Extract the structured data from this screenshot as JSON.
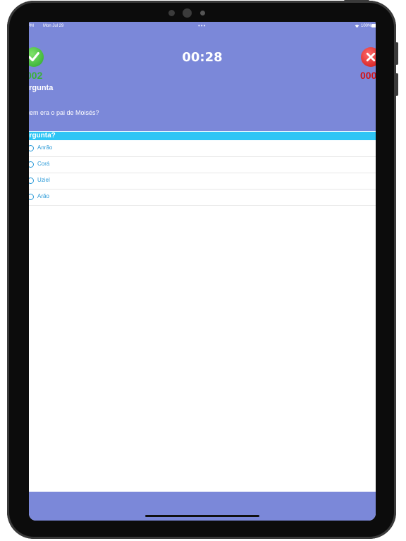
{
  "status_bar": {
    "time": "PM",
    "date": "Mon Jul 29",
    "dots": "•••",
    "wifi": "wifi-icon",
    "battery": "100%"
  },
  "quiz": {
    "timer": "00:28",
    "correct_icon": "check-icon",
    "wrong_icon": "x-icon",
    "correct_score": "002",
    "wrong_score": "000",
    "heading": "ergunta",
    "question": "uem era o pai de Moisés?",
    "section_header": "ergunta?",
    "options": [
      {
        "label": "Anrão"
      },
      {
        "label": "Corá"
      },
      {
        "label": "Uziel"
      },
      {
        "label": "Arão"
      }
    ]
  },
  "colors": {
    "header_bg": "#7b88d9",
    "section_bg": "#2ec5f5",
    "option_text": "#2b9ad8",
    "correct": "#3ab03a",
    "wrong": "#d41414"
  }
}
